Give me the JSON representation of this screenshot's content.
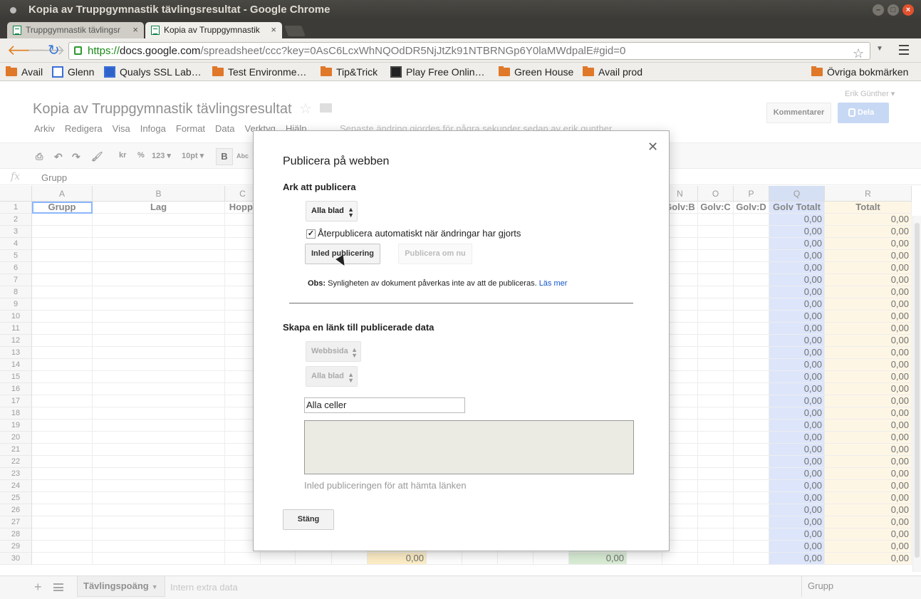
{
  "window": {
    "title": "Kopia av Truppgymnastik tävlingsresultat - Google Chrome"
  },
  "tabs": [
    {
      "label": "Truppgymnastik tävlingsr"
    },
    {
      "label": "Kopia av Truppgymnastik"
    }
  ],
  "omnibox": {
    "scheme": "https://",
    "host": "docs.google.com",
    "path": "/spreadsheet/ccc?key=0AsC6LcxWhNQOdDR5NjJtZk91NTBRNGp6Y0laMWdpalE#gid=0"
  },
  "bookmarks": [
    {
      "label": "Avail",
      "icon": "folder-icon"
    },
    {
      "label": "Glenn",
      "icon": "page-icon"
    },
    {
      "label": "Qualys SSL Lab…",
      "icon": "qualys-icon"
    },
    {
      "label": "Test Environme…",
      "icon": "folder-icon"
    },
    {
      "label": "Tip&Trick",
      "icon": "folder-icon"
    },
    {
      "label": "Play Free Onlin…",
      "icon": "game-icon"
    },
    {
      "label": "Green House",
      "icon": "folder-icon"
    },
    {
      "label": "Avail prod",
      "icon": "folder-icon"
    },
    {
      "label": "Övriga bokmärken",
      "icon": "folder-icon"
    }
  ],
  "doc": {
    "title": "Kopia av Truppgymnastik tävlingsresultat",
    "user": "Erik Günther ▾",
    "comment_label": "Kommentarer",
    "share_label": "Dela",
    "menus": [
      "Arkiv",
      "Redigera",
      "Visa",
      "Infoga",
      "Format",
      "Data",
      "Verktyg",
      "Hjälp"
    ],
    "last_edit": "Senaste ändring gjordes för några sekunder sedan av erik.gunther"
  },
  "toolbar": {
    "currency": "kr",
    "percent": "%",
    "numfmt": "123 ▾",
    "fontsize": "10pt ▾",
    "bold": "B",
    "strike": "Abc"
  },
  "formula": {
    "fx": "fx",
    "value": "Grupp"
  },
  "grid": {
    "columns_left": [
      "A",
      "B",
      "C"
    ],
    "columns_right": [
      "N",
      "O",
      "P",
      "Q",
      "R"
    ],
    "headers_left": [
      "Grupp",
      "Lag",
      "Hopp:"
    ],
    "headers_right": [
      "Golv:B",
      "Golv:C",
      "Golv:D",
      "Golv Totalt",
      "Totalt"
    ],
    "cell_value": "0,00",
    "rows": [
      1,
      2,
      3,
      4,
      5,
      6,
      7,
      8,
      9,
      10,
      11,
      12,
      13,
      14,
      15,
      16,
      17,
      18,
      19,
      20,
      21,
      22,
      23,
      24,
      25,
      26,
      27,
      28,
      29,
      30
    ]
  },
  "bottom": {
    "active_sheet": "Tävlingspoäng",
    "other_sheet": "Intern extra data",
    "selection": "Grupp"
  },
  "dialog": {
    "title": "Publicera på webben",
    "section1": "Ark att publicera",
    "sheets_select": "Alla blad",
    "auto_republish": "Återpublicera automatiskt när ändringar har gjorts",
    "start_button": "Inled publicering",
    "republish_button": "Publicera om nu",
    "note_label": "Obs:",
    "note_text": " Synligheten av dokument påverkas inte av att de publiceras. ",
    "note_link": "Läs mer",
    "section2": "Skapa en länk till publicerade data",
    "format_select": "Webbsida",
    "sheet_select2": "Alla blad",
    "range_input": "Alla celler",
    "hint": "Inled publiceringen för att hämta länken",
    "close_button": "Stäng"
  }
}
